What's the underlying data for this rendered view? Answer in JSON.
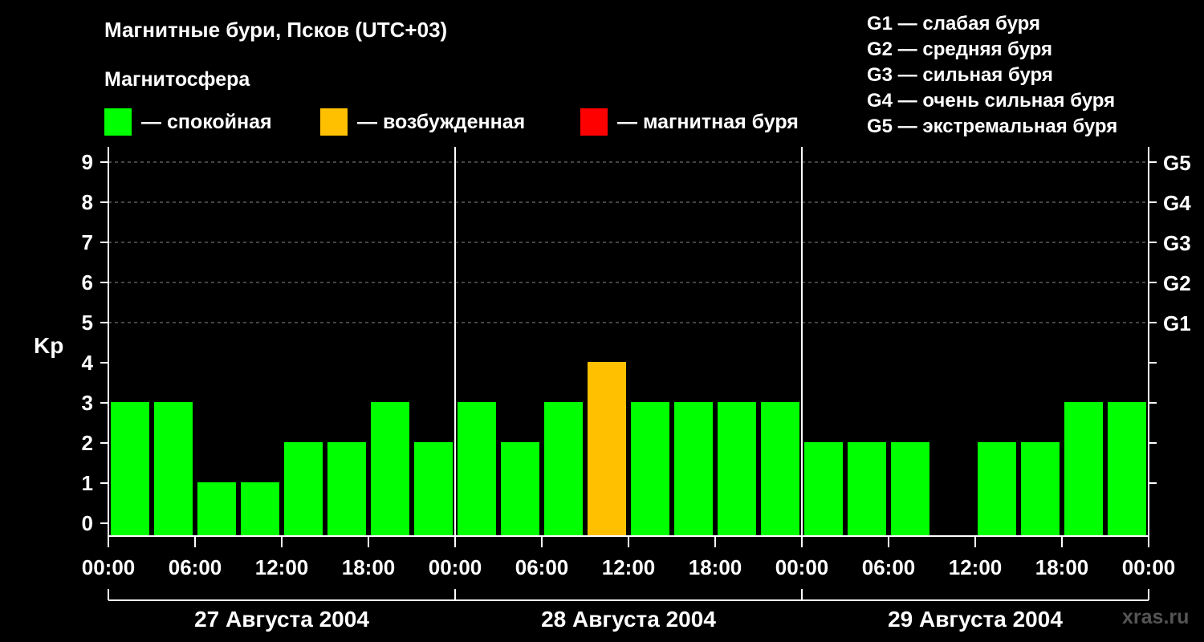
{
  "title": "Магнитные бури, Псков (UTC+03)",
  "subtitle": "Магнитосфера",
  "legend": [
    {
      "label": "— спокойная",
      "color": "#00ff00"
    },
    {
      "label": "— возбужденная",
      "color": "#ffc000"
    },
    {
      "label": "— магнитная буря",
      "color": "#ff0000"
    }
  ],
  "storm_legend": [
    "G1 — слабая буря",
    "G2 — средняя буря",
    "G3 — сильная буря",
    "G4 — очень сильная буря",
    "G5 — экстремальная буря"
  ],
  "watermark": "xras.ru",
  "chart_data": {
    "type": "bar",
    "ylabel": "Kp",
    "ylim": [
      0,
      9
    ],
    "yticks": [
      0,
      1,
      2,
      3,
      4,
      5,
      6,
      7,
      8,
      9
    ],
    "right_ticks": [
      {
        "value": 5,
        "label": "G1"
      },
      {
        "value": 6,
        "label": "G2"
      },
      {
        "value": 7,
        "label": "G3"
      },
      {
        "value": 8,
        "label": "G4"
      },
      {
        "value": 9,
        "label": "G5"
      }
    ],
    "grid_y": [
      5,
      6,
      7,
      8,
      9
    ],
    "x_tick_labels": [
      "00:00",
      "06:00",
      "12:00",
      "18:00",
      "00:00",
      "06:00",
      "12:00",
      "18:00",
      "00:00",
      "06:00",
      "12:00",
      "18:00",
      "00:00"
    ],
    "days": [
      "27 Августа 2004",
      "28 Августа 2004",
      "29 Августа 2004"
    ],
    "bin_hours": 3,
    "values": [
      3,
      3,
      1,
      1,
      2,
      2,
      3,
      2,
      3,
      2,
      3,
      4,
      3,
      3,
      3,
      3,
      2,
      2,
      2,
      0,
      2,
      2,
      3,
      3
    ],
    "colors": {
      "quiet": "#00ff00",
      "active": "#ffc000",
      "storm": "#ff0000"
    }
  }
}
